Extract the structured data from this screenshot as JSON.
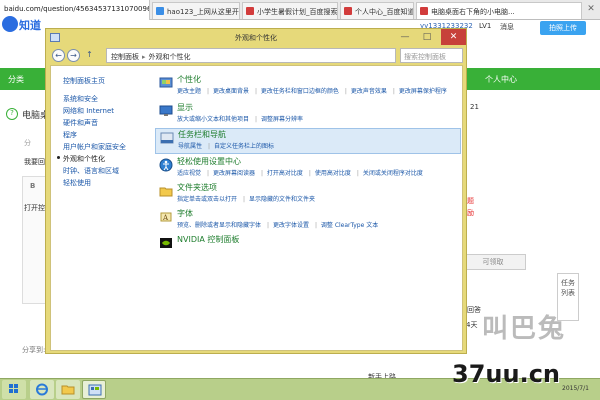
{
  "browser": {
    "address": "baidu.com/question/456345371310700965",
    "tabs": [
      {
        "label": "hao123_上网从这里开始",
        "color": "#3a8ee6"
      },
      {
        "label": "小学生暑假计划_百度搜索",
        "color": "#d23c3c"
      },
      {
        "label": "个人中心_百度知道",
        "color": "#d23c3c"
      },
      {
        "label": "电脑桌面右下角的小电脑...",
        "color": "#d23c3c"
      }
    ],
    "close_glyph": "✕"
  },
  "baidu": {
    "logo_text": "知道",
    "user_id": "yy1331233232",
    "level": "LV1",
    "messages": "消息",
    "share_button": "拍照上传",
    "nav_category": "分类",
    "nav_personal": "个人中心",
    "question_icon": "?",
    "question_title": "电脑桌",
    "left_text_1": "分",
    "left_text_2": "我要回答",
    "editor_label": "B",
    "left_text_3": "打开控",
    "left_text_4": "分享到:",
    "right_number": "21",
    "right_text_a": "问",
    "right_text_b": "问题",
    "right_text_c": "奖励",
    "right_button": "可领取",
    "right_text_d": "已回答",
    "right_text_e": "4天",
    "task_box": "任务列表",
    "new_user": "新手上路"
  },
  "control_panel": {
    "title": "外观和个性化",
    "controls": {
      "minimize": "—",
      "maximize": "□",
      "close": "✕"
    },
    "breadcrumb": [
      "控制面板",
      "外观和个性化"
    ],
    "search_placeholder": "搜索控制面板",
    "left_nav": [
      {
        "label": "控制面板主页",
        "current": false
      },
      {
        "label": "系统和安全",
        "current": false
      },
      {
        "label": "网络和 Internet",
        "current": false
      },
      {
        "label": "硬件和声音",
        "current": false
      },
      {
        "label": "程序",
        "current": false
      },
      {
        "label": "用户帐户和家庭安全",
        "current": false
      },
      {
        "label": "外观和个性化",
        "current": true
      },
      {
        "label": "时钟、语言和区域",
        "current": false
      },
      {
        "label": "轻松使用",
        "current": false
      }
    ],
    "categories": [
      {
        "title": "个性化",
        "icon": "personalization-icon",
        "links": [
          "更改主题",
          "更改桌面背景",
          "更改任务栏和窗口边框的颜色",
          "更改声音效果",
          "更改屏幕保护程序"
        ]
      },
      {
        "title": "显示",
        "icon": "display-icon",
        "links": [
          "放大或缩小文本和其他项目",
          "调整屏幕分辨率"
        ]
      },
      {
        "title": "任务栏和导航",
        "icon": "taskbar-icon",
        "links": [
          "导航属性",
          "自定义任务栏上的图标"
        ]
      },
      {
        "title": "轻松使用设置中心",
        "icon": "ease-of-access-icon",
        "links": [
          "适应视觉",
          "更改屏幕阅读器",
          "打开高对比度",
          "使用高对比度",
          "关闭或关闭程序对比度"
        ]
      },
      {
        "title": "文件夹选项",
        "icon": "folder-options-icon",
        "links": [
          "指定单击或双击以打开",
          "显示隐藏的文件和文件夹"
        ]
      },
      {
        "title": "字体",
        "icon": "fonts-icon",
        "links": [
          "预览、删除或者显示和隐藏字体",
          "更改字体设置",
          "调整 ClearType 文本"
        ]
      },
      {
        "title": "NVIDIA 控制面板",
        "icon": "nvidia-icon",
        "links": []
      }
    ]
  },
  "taskbar": {
    "clock": "2015/7/1"
  },
  "watermark": {
    "logo": "叫巴兔",
    "site": "37uu.cn"
  },
  "colors": {
    "baidu_green": "#39b038",
    "window_frame": "#e6d97a",
    "link_blue": "#1b57a8",
    "category_green": "#1e7d2d"
  }
}
